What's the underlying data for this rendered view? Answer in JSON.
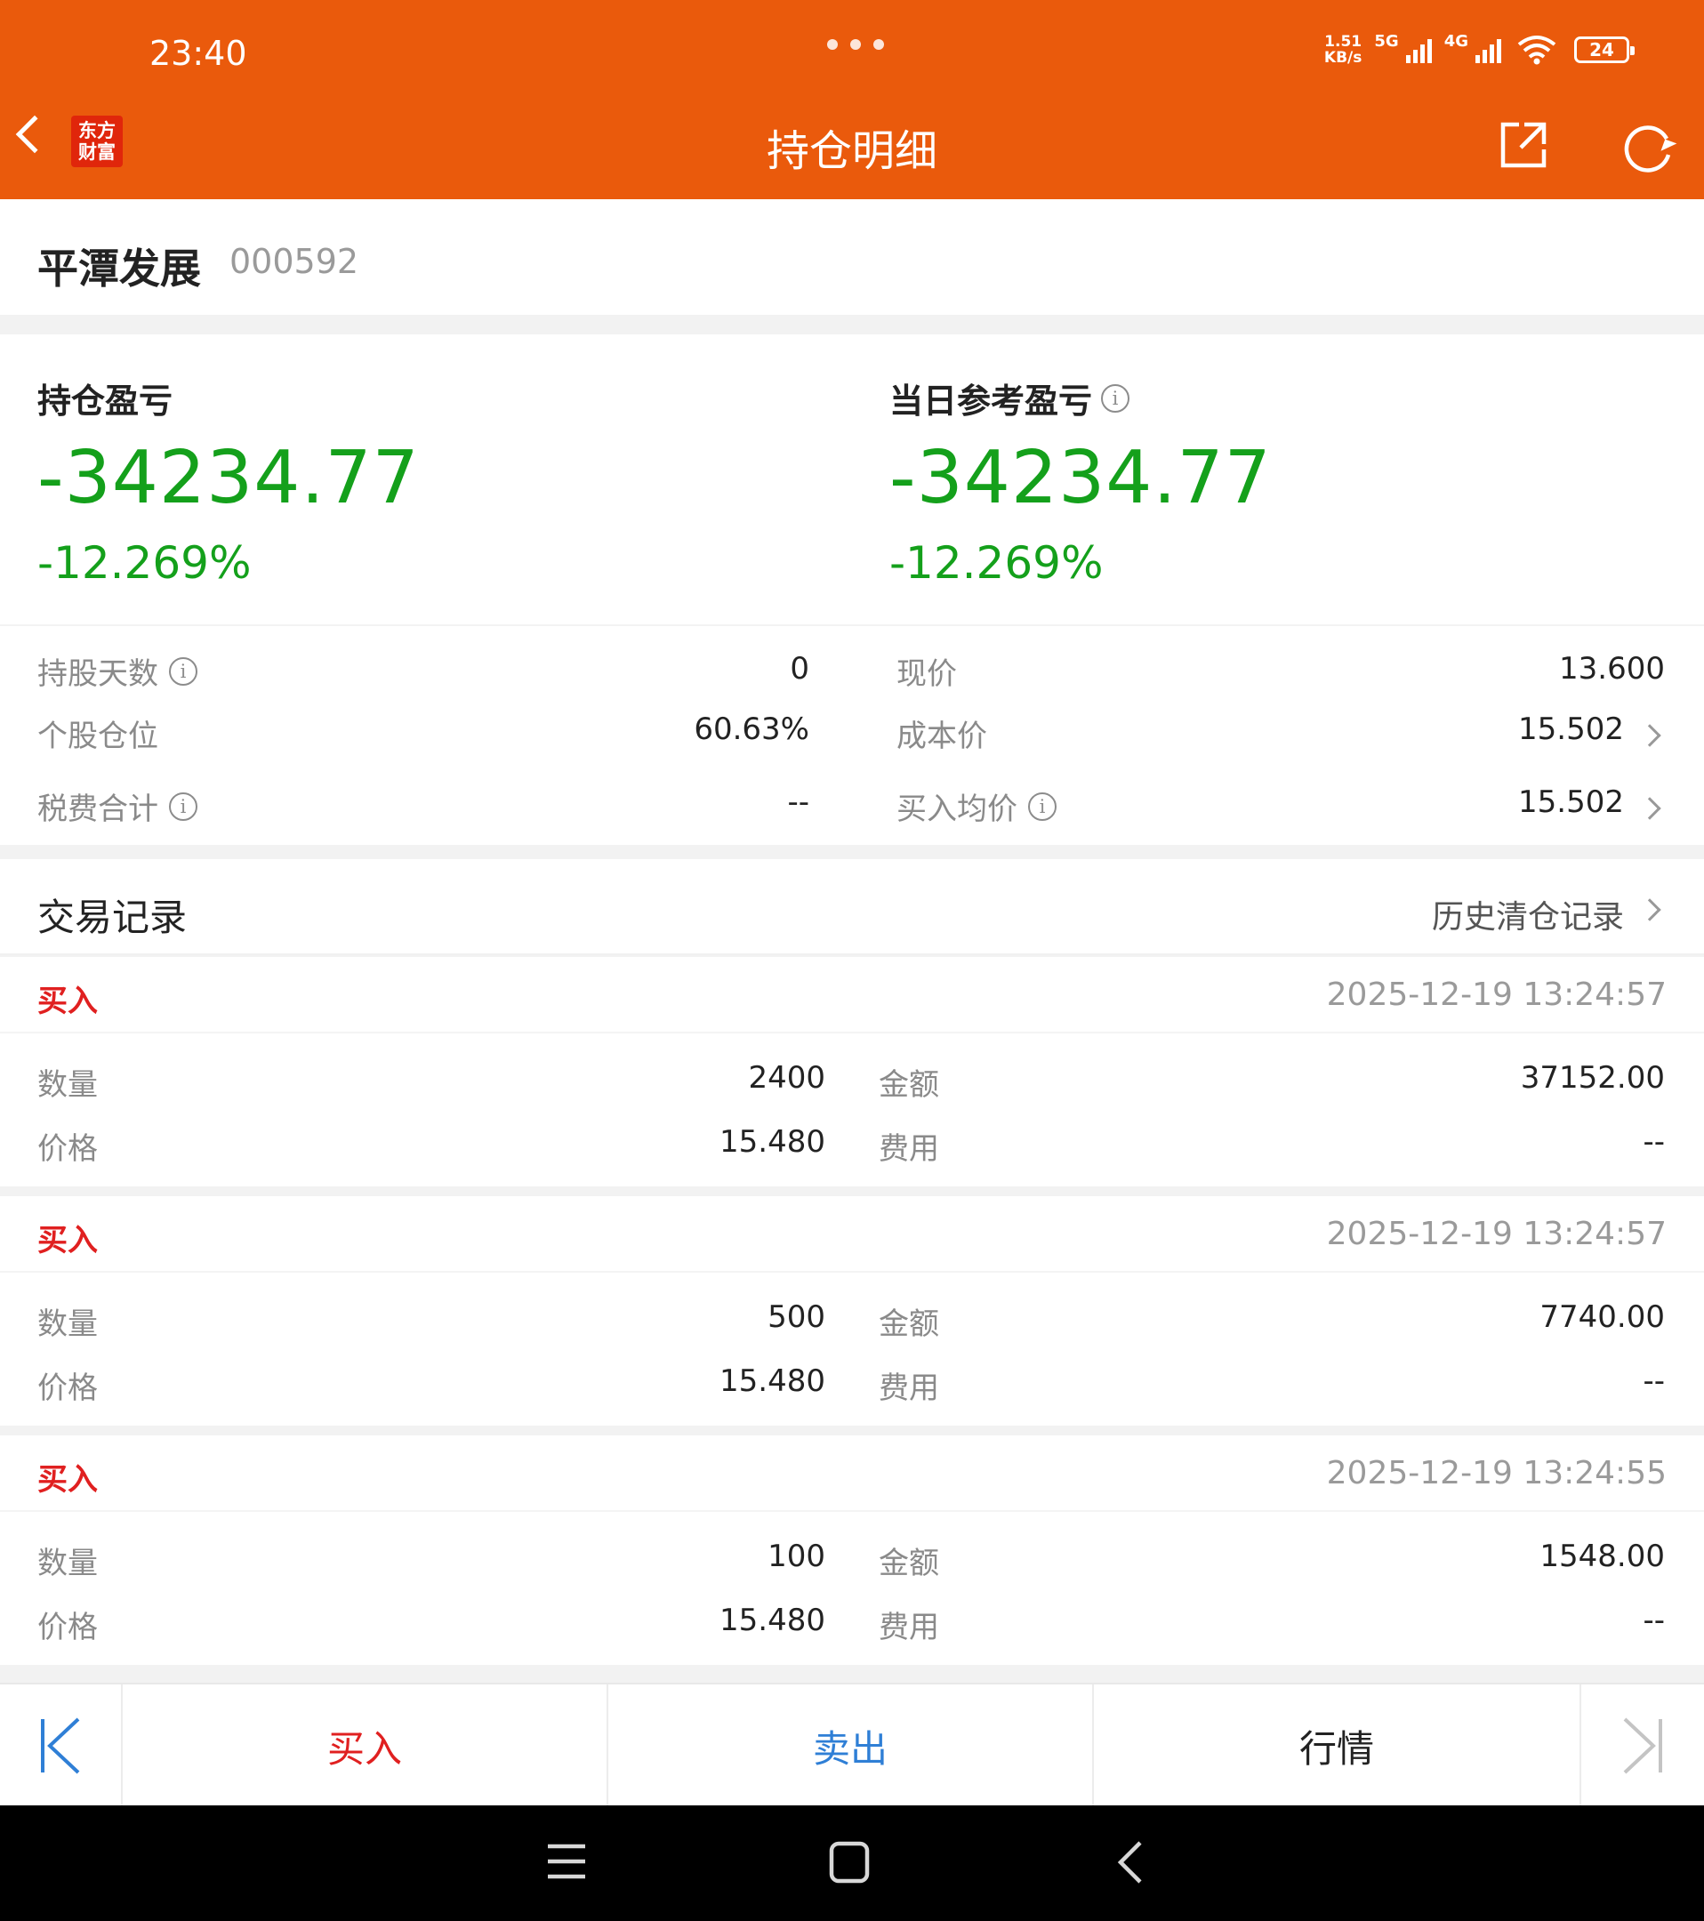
{
  "status": {
    "time": "23:40",
    "speed_top": "1.51",
    "speed_unit": "KB/s",
    "net1": "5G",
    "net2": "4G",
    "battery": "24"
  },
  "header": {
    "title": "持仓明细",
    "logo_line1": "东方",
    "logo_line2": "财富",
    "accent": "#ea5a0c"
  },
  "stock": {
    "name": "平潭发展",
    "code": "000592"
  },
  "summary": {
    "hold_label": "持仓盈亏",
    "hold_value": "-34234.77",
    "hold_pct": "-12.269%",
    "today_label": "当日参考盈亏",
    "today_value": "-34234.77",
    "today_pct": "-12.269%",
    "loss_color": "#14a01b"
  },
  "details": {
    "days_label": "持股天数",
    "days_value": "0",
    "position_label": "个股仓位",
    "position_value": "60.63%",
    "fees_label": "税费合计",
    "fees_value": "--",
    "price_label": "现价",
    "price_value": "13.600",
    "cost_label": "成本价",
    "cost_value": "15.502",
    "avg_label": "买入均价",
    "avg_value": "15.502"
  },
  "trades": {
    "title": "交易记录",
    "history_link": "历史清仓记录",
    "labels": {
      "qty": "数量",
      "price": "价格",
      "amount": "金额",
      "fee": "费用"
    },
    "items": [
      {
        "type": "买入",
        "time": "2025-12-19 13:24:57",
        "qty": "2400",
        "price": "15.480",
        "amount": "37152.00",
        "fee": "--"
      },
      {
        "type": "买入",
        "time": "2025-12-19 13:24:57",
        "qty": "500",
        "price": "15.480",
        "amount": "7740.00",
        "fee": "--"
      },
      {
        "type": "买入",
        "time": "2025-12-19 13:24:55",
        "qty": "100",
        "price": "15.480",
        "amount": "1548.00",
        "fee": "--"
      }
    ]
  },
  "actions": {
    "buy": "买入",
    "sell": "卖出",
    "quote": "行情",
    "buy_color": "#e02020",
    "sell_color": "#2f7fd6"
  }
}
